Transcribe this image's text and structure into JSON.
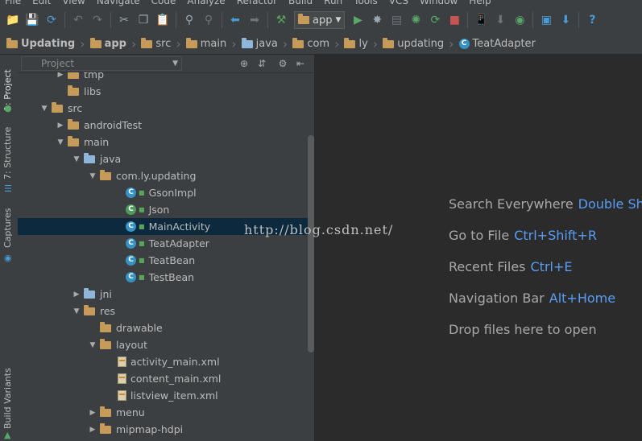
{
  "menu": [
    "File",
    "Edit",
    "View",
    "Navigate",
    "Code",
    "Analyze",
    "Refactor",
    "Build",
    "Run",
    "Tools",
    "VCS",
    "Window",
    "Help"
  ],
  "toolbar": {
    "run_config": "app"
  },
  "breadcrumb": [
    {
      "label": "Updating",
      "icon": "folder-icon",
      "bold": true
    },
    {
      "label": "app",
      "icon": "folder-icon",
      "bold": true
    },
    {
      "label": "src",
      "icon": "folder-icon"
    },
    {
      "label": "main",
      "icon": "folder-icon"
    },
    {
      "label": "java",
      "icon": "folder-icon"
    },
    {
      "label": "com",
      "icon": "folder-icon"
    },
    {
      "label": "ly",
      "icon": "folder-icon"
    },
    {
      "label": "updating",
      "icon": "folder-icon"
    },
    {
      "label": "TeatAdapter",
      "icon": "class-icon"
    }
  ],
  "side_tabs": {
    "project": "1: Project",
    "structure": "7: Structure",
    "captures": "Captures",
    "build_variants": "Build Variants"
  },
  "project_panel": {
    "view_mode": "Project"
  },
  "tree": [
    {
      "label": "tmp",
      "type": "folder",
      "depth": 3,
      "arrow": "right"
    },
    {
      "label": "libs",
      "type": "folder",
      "depth": 3,
      "arrow": ""
    },
    {
      "label": "src",
      "type": "folder",
      "depth": 2,
      "arrow": "down"
    },
    {
      "label": "androidTest",
      "type": "folder",
      "depth": 3,
      "arrow": "right"
    },
    {
      "label": "main",
      "type": "folder",
      "depth": 3,
      "arrow": "down"
    },
    {
      "label": "java",
      "type": "folder-blue",
      "depth": 4,
      "arrow": "down"
    },
    {
      "label": "com.ly.updating",
      "type": "folder",
      "depth": 5,
      "arrow": "down"
    },
    {
      "label": "GsonImpl",
      "type": "class",
      "depth": 6,
      "arrow": ""
    },
    {
      "label": "Json",
      "type": "class-green",
      "depth": 6,
      "arrow": ""
    },
    {
      "label": "MainActivity",
      "type": "class",
      "depth": 6,
      "arrow": "",
      "selected": true
    },
    {
      "label": "TeatAdapter",
      "type": "class",
      "depth": 6,
      "arrow": ""
    },
    {
      "label": "TeatBean",
      "type": "class",
      "depth": 6,
      "arrow": ""
    },
    {
      "label": "TestBean",
      "type": "class",
      "depth": 6,
      "arrow": ""
    },
    {
      "label": "jni",
      "type": "folder-blue",
      "depth": 4,
      "arrow": "right"
    },
    {
      "label": "res",
      "type": "folder",
      "depth": 4,
      "arrow": "down"
    },
    {
      "label": "drawable",
      "type": "folder",
      "depth": 5,
      "arrow": ""
    },
    {
      "label": "layout",
      "type": "folder",
      "depth": 5,
      "arrow": "down"
    },
    {
      "label": "activity_main.xml",
      "type": "xml",
      "depth": 6,
      "arrow": ""
    },
    {
      "label": "content_main.xml",
      "type": "xml",
      "depth": 6,
      "arrow": ""
    },
    {
      "label": "listview_item.xml",
      "type": "xml",
      "depth": 6,
      "arrow": ""
    },
    {
      "label": "menu",
      "type": "folder",
      "depth": 5,
      "arrow": "right"
    },
    {
      "label": "mipmap-hdpi",
      "type": "folder",
      "depth": 5,
      "arrow": "right"
    }
  ],
  "editor_hints": [
    {
      "text": "Search Everywhere",
      "key": "Double Shift"
    },
    {
      "text": "Go to File",
      "key": "Ctrl+Shift+R"
    },
    {
      "text": "Recent Files",
      "key": "Ctrl+E"
    },
    {
      "text": "Navigation Bar",
      "key": "Alt+Home"
    },
    {
      "text": "Drop files here to open",
      "key": ""
    }
  ],
  "watermark": "http://blog.csdn.net/"
}
